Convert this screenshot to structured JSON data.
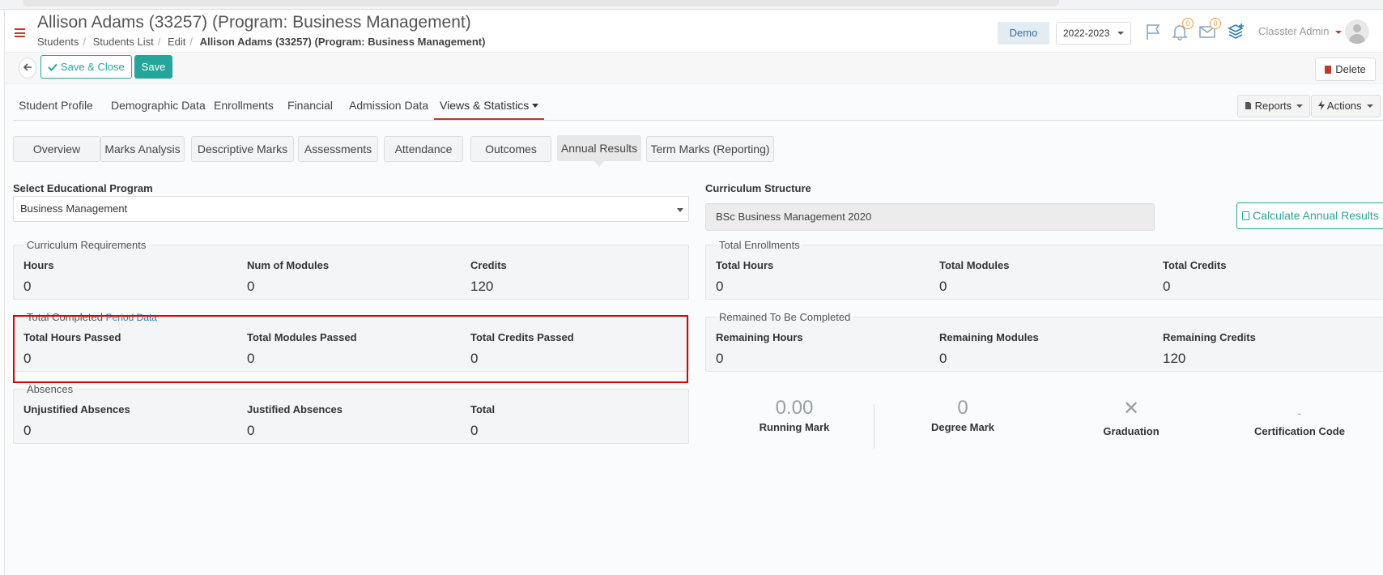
{
  "header": {
    "title": "Allison Adams (33257) (Program: Business Management)",
    "breadcrumb": [
      "Students",
      "Students List",
      "Edit",
      "Allison Adams (33257) (Program: Business Management)"
    ],
    "env_badge": "Demo",
    "academic_year": "2022-2023",
    "notifications_count": "0",
    "messages_count": "0",
    "user_name": "Classter Admin"
  },
  "toolbar": {
    "save_close_label": "Save & Close",
    "save_label": "Save",
    "delete_label": "Delete"
  },
  "main_tabs": [
    "Student Profile",
    "Demographic Data",
    "Enrollments",
    "Financial",
    "Admission Data",
    "Views & Statistics"
  ],
  "active_main_tab": "Views & Statistics",
  "right_buttons": {
    "reports": "Reports",
    "actions": "Actions"
  },
  "sub_tabs": [
    "Overview",
    "Marks Analysis",
    "Descriptive Marks",
    "Assessments",
    "Attendance",
    "Outcomes",
    "Annual Results",
    "Term Marks (Reporting)"
  ],
  "active_sub_tab": "Annual Results",
  "program": {
    "label": "Select Educational Program",
    "value": "Business Management"
  },
  "curriculum_structure": {
    "label": "Curriculum Structure",
    "value": "BSc Business Management 2020"
  },
  "calc_button": "Calculate Annual Results",
  "curriculum_requirements": {
    "legend": "Curriculum Requirements",
    "cols": [
      {
        "label": "Hours",
        "value": "0"
      },
      {
        "label": "Num of Modules",
        "value": "0"
      },
      {
        "label": "Credits",
        "value": "120"
      }
    ]
  },
  "total_completed": {
    "legend": "Total Completed",
    "link": "Period Data",
    "cols": [
      {
        "label": "Total Hours Passed",
        "value": "0"
      },
      {
        "label": "Total Modules Passed",
        "value": "0"
      },
      {
        "label": "Total Credits Passed",
        "value": "0"
      }
    ]
  },
  "absences": {
    "legend": "Absences",
    "cols": [
      {
        "label": "Unjustified Absences",
        "value": "0"
      },
      {
        "label": "Justified Absences",
        "value": "0"
      },
      {
        "label": "Total",
        "value": "0"
      }
    ]
  },
  "total_enrollments": {
    "legend": "Total Enrollments",
    "cols": [
      {
        "label": "Total Hours",
        "value": "0"
      },
      {
        "label": "Total Modules",
        "value": "0"
      },
      {
        "label": "Total Credits",
        "value": "0"
      }
    ]
  },
  "remained": {
    "legend": "Remained To Be Completed",
    "cols": [
      {
        "label": "Remaining Hours",
        "value": "0"
      },
      {
        "label": "Remaining Modules",
        "value": "0"
      },
      {
        "label": "Remaining Credits",
        "value": "120"
      }
    ]
  },
  "stats": {
    "running_mark": {
      "value": "0.00",
      "label": "Running Mark"
    },
    "degree_mark": {
      "value": "0",
      "label": "Degree Mark"
    },
    "graduation": {
      "value": "✕",
      "label": "Graduation"
    },
    "certification": {
      "value": "-",
      "label": "Certification Code"
    }
  }
}
